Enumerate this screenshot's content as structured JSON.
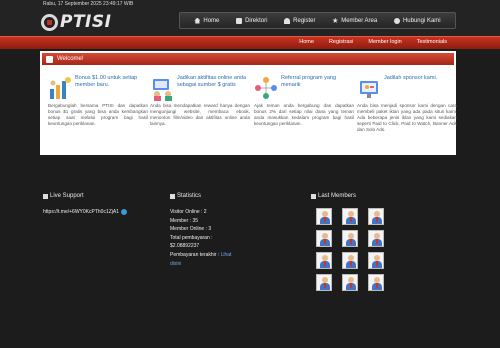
{
  "header": {
    "datetime": "Rabu, 17 September 2025 23:49:17 WIB",
    "logo_text": "PTISI"
  },
  "main_nav": [
    {
      "label": "Home",
      "icon": "home-icon"
    },
    {
      "label": "Direktori",
      "icon": "directory-icon"
    },
    {
      "label": "Register",
      "icon": "register-icon"
    },
    {
      "label": "Member Area",
      "icon": "star-icon"
    },
    {
      "label": "Hubungi Kami",
      "icon": "contact-icon"
    }
  ],
  "sub_nav": [
    "Home",
    "Registrasi",
    "Member login",
    "Testimonials"
  ],
  "welcome": {
    "title": "Welcome!"
  },
  "features": [
    {
      "title": "Bonus $1.00 untuk setiap member baru.",
      "desc": "Bergabunglah bersama PTISI dan dapatkan bonus $1 gratis yang bisa anda kembangkan setiap saat melalui program bagi hasil keuntungan periklanan."
    },
    {
      "title": "Jadikan aktifitas online anda sebagai sumber $ gratis",
      "desc": "Anda bisa mendapatkan reward hanya dengan mengunjungi website, membaca ebook, menonton film/video dan aktifitas online anda lainnya."
    },
    {
      "title": "Referral program yang menarik",
      "desc": "Ajak teman anda bergabung dan dapatkan bonus 2% dari setiap nilai dana yang teman anda masukkan kedalam program bagi hasil keuntungan periklanan."
    },
    {
      "title": "Jadilah sponsor kami.",
      "desc": "Anda bisa menjadi sponsor kami dengan cara membeli paket iklan yang ada pada situs kami. Ada beberapa jenis iklan yang kami sediakan seperti Paid to Click, Paid to Watch, Banner Ads dan Solo Ads."
    }
  ],
  "footer": {
    "live_support": {
      "title": "Live Support",
      "link": "https://t.me/+6WY0KcPTh0c1ZjA1"
    },
    "statistics": {
      "title": "Statistics",
      "visitor_online": "Visitor Online : 2",
      "member": "Member : 35",
      "member_online": "Member Online : 3",
      "total_label": "Total pembayaran :",
      "total_value": "$2.08892237",
      "last_payment_label": "Pembayaran terakhir :",
      "last_payment_link": "Lihat disini"
    },
    "last_members": {
      "title": "Last Members",
      "count": 12
    }
  },
  "colors": {
    "accent_red": "#c8321f",
    "link_blue": "#2b6cb0",
    "background": "#1c1c1c"
  }
}
